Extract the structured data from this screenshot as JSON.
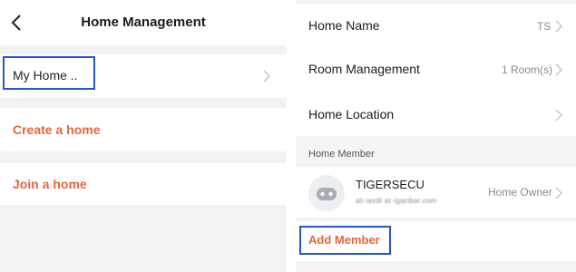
{
  "left": {
    "header": {
      "title": "Home Management",
      "back_icon": "chevron-left-icon"
    },
    "homes": [
      {
        "label": "My Home .."
      }
    ],
    "create_label": "Create a home",
    "join_label": "Join a home"
  },
  "right": {
    "home_name": {
      "label": "Home Name",
      "value": "TS"
    },
    "room_management": {
      "label": "Room Management",
      "value": "1 Room(s)"
    },
    "home_location": {
      "label": "Home Location"
    },
    "members_section": "Home Member",
    "member": {
      "name": "TIGERSECU",
      "email": "ali iaxdi ar-igaribar.com",
      "role": "Home Owner"
    },
    "add_member_label": "Add Member"
  },
  "colors": {
    "accent": "#e8673a",
    "highlight_box": "#2457c9",
    "background": "#f2f2f4"
  }
}
